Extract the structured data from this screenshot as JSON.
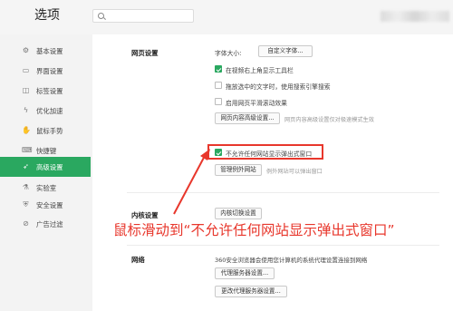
{
  "header": {
    "title": "选项",
    "search_placeholder": ""
  },
  "sidebar": {
    "items": [
      {
        "label": "基本设置",
        "icon": "gear-icon",
        "glyph": "⚙"
      },
      {
        "label": "界面设置",
        "icon": "window-icon",
        "glyph": "▭"
      },
      {
        "label": "标签设置",
        "icon": "tab-icon",
        "glyph": "◫"
      },
      {
        "label": "优化加速",
        "icon": "lightning-icon",
        "glyph": "ϟ"
      },
      {
        "label": "鼠标手势",
        "icon": "hand-icon",
        "glyph": "✋"
      },
      {
        "label": "快捷键",
        "icon": "keyboard-icon",
        "glyph": "⌨"
      },
      {
        "label": "高级设置",
        "icon": "rocket-icon",
        "glyph": "➶",
        "active": true
      },
      {
        "label": "实验室",
        "icon": "flask-icon",
        "glyph": "⚗"
      },
      {
        "label": "安全设置",
        "icon": "shield-icon",
        "glyph": "⛨"
      },
      {
        "label": "广告过滤",
        "icon": "block-icon",
        "glyph": "⊘"
      }
    ]
  },
  "web": {
    "section": "网页设置",
    "font_size_label": "字体大小:",
    "custom_font_button": "自定义字体...",
    "options": [
      {
        "label": "在视频右上角显示工具栏",
        "checked": true
      },
      {
        "label": "拖放选中的文字时，使用搜索引擎搜索",
        "checked": false
      },
      {
        "label": "启用网页平滑滚动效果",
        "checked": false
      }
    ],
    "advanced_button": "网页内容高级设置...",
    "advanced_note": "网页内容高级设置仅对极速模式生效",
    "popup_option": {
      "label": "不允许任何网站显示弹出式窗口",
      "checked": true
    },
    "exceptions_button": "管理例外网站",
    "exceptions_note": "例外网站可以弹出窗口"
  },
  "kernel": {
    "section": "内核设置",
    "button": "内核切换设置"
  },
  "network": {
    "section": "网络",
    "description": "360安全浏览器会使用您计算机的系统代理设置连接到网络",
    "proxy_button": "代理服务器设置...",
    "change_proxy_button": "更改代理服务器设置..."
  },
  "annotation": {
    "text": "鼠标滑动到“不允许任何网站显示弹出式窗口”",
    "color": "#e8372c"
  },
  "colors": {
    "accent": "#2aa860",
    "annotation_red": "#e8372c"
  }
}
